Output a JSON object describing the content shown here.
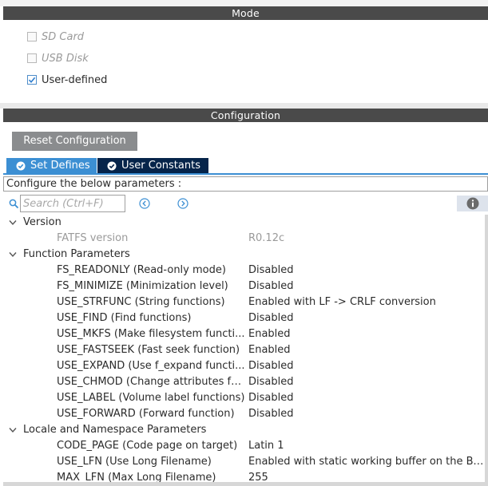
{
  "mode": {
    "title": "Mode",
    "options": [
      {
        "label": "SD Card",
        "checked": false,
        "enabled": false
      },
      {
        "label": "USB Disk",
        "checked": false,
        "enabled": false
      },
      {
        "label": "User-defined",
        "checked": true,
        "enabled": true
      }
    ]
  },
  "configuration": {
    "title": "Configuration",
    "reset_label": "Reset Configuration",
    "tabs": [
      {
        "label": "Set Defines",
        "active": true
      },
      {
        "label": "User Constants",
        "active": false
      }
    ],
    "description": "Configure the below parameters :",
    "search": {
      "placeholder": "Search (Ctrl+F)",
      "value": ""
    }
  },
  "tree": {
    "groups": [
      {
        "label": "Version",
        "params": [
          {
            "name": "FATFS version",
            "value": "R0.12c",
            "readonly": true
          }
        ]
      },
      {
        "label": "Function Parameters",
        "params": [
          {
            "name": "FS_READONLY (Read-only mode)",
            "value": "Disabled"
          },
          {
            "name": "FS_MINIMIZE (Minimization level)",
            "value": "Disabled"
          },
          {
            "name": "USE_STRFUNC (String functions)",
            "value": "Enabled with LF -> CRLF conversion"
          },
          {
            "name": "USE_FIND (Find functions)",
            "value": "Disabled"
          },
          {
            "name": "USE_MKFS (Make filesystem functi...",
            "value": "Enabled"
          },
          {
            "name": "USE_FASTSEEK (Fast seek function)",
            "value": "Enabled"
          },
          {
            "name": "USE_EXPAND (Use f_expand functi...",
            "value": "Disabled"
          },
          {
            "name": "USE_CHMOD (Change attributes fu...",
            "value": "Disabled"
          },
          {
            "name": "USE_LABEL (Volume label functions)",
            "value": "Disabled"
          },
          {
            "name": "USE_FORWARD (Forward function)",
            "value": "Disabled"
          }
        ]
      },
      {
        "label": "Locale and Namespace Parameters",
        "params": [
          {
            "name": "CODE_PAGE (Code page on target)",
            "value": "Latin 1"
          },
          {
            "name": "USE_LFN (Use Long Filename)",
            "value": "Enabled with static working buffer on the BSS"
          },
          {
            "name": "MAX_LFN (Max Long Filename)",
            "value": "255"
          }
        ]
      }
    ]
  },
  "icons": {
    "checkbox_check": "check-icon",
    "tab_status": "check-circle-icon",
    "search": "search-icon",
    "prev": "arrow-left-circle-icon",
    "next": "arrow-right-circle-icon",
    "info": "info-icon",
    "expand": "chevron-down-icon"
  },
  "colors": {
    "section_bar": "#4a4a4a",
    "tab_active": "#3c8fd3",
    "tab_inactive": "#06244a",
    "reset_button": "#8a8c8e",
    "checkbox_accent": "#4f8dc9"
  }
}
